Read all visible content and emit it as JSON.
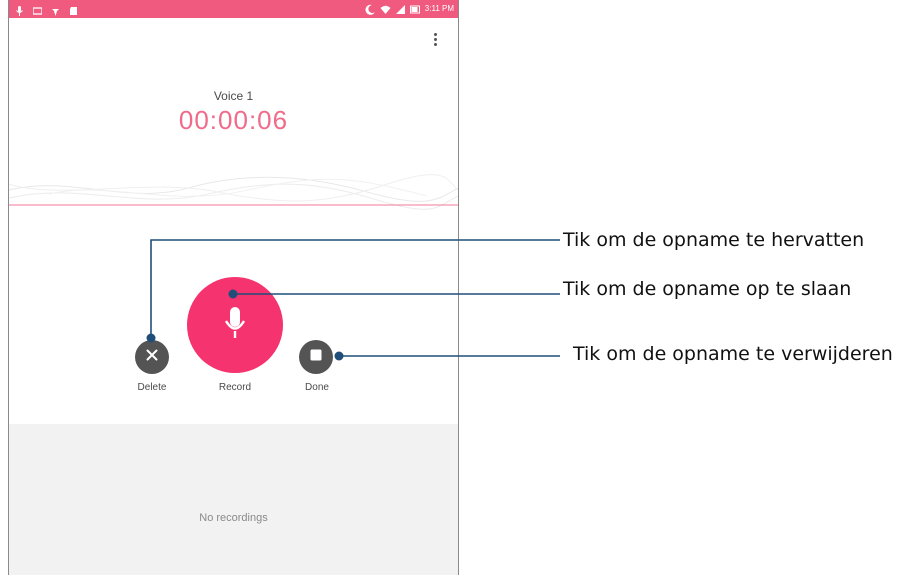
{
  "statusbar": {
    "time": "3:11 PM",
    "icons_left": [
      "microphone-icon",
      "message-icon",
      "pin-icon",
      "sd-card-icon"
    ],
    "icons_right": [
      "moon-icon",
      "wifi-icon",
      "signal-icon",
      "battery-icon"
    ]
  },
  "recorder": {
    "name": "Voice 1",
    "elapsed": "00:00:06",
    "delete_label": "Delete",
    "record_label": "Record",
    "done_label": "Done",
    "empty_text": "No recordings"
  },
  "callouts": {
    "resume": "Tik om de opname te hervatten",
    "save": "Tik om de opname op te slaan",
    "delete": "Tik om de opname te verwijderen"
  },
  "colors": {
    "statusbar": "#f05a7e",
    "accent": "#f5336e",
    "timer": "#f06b8a",
    "secondary_button": "#545454",
    "callout_line": "#1f4e79"
  }
}
